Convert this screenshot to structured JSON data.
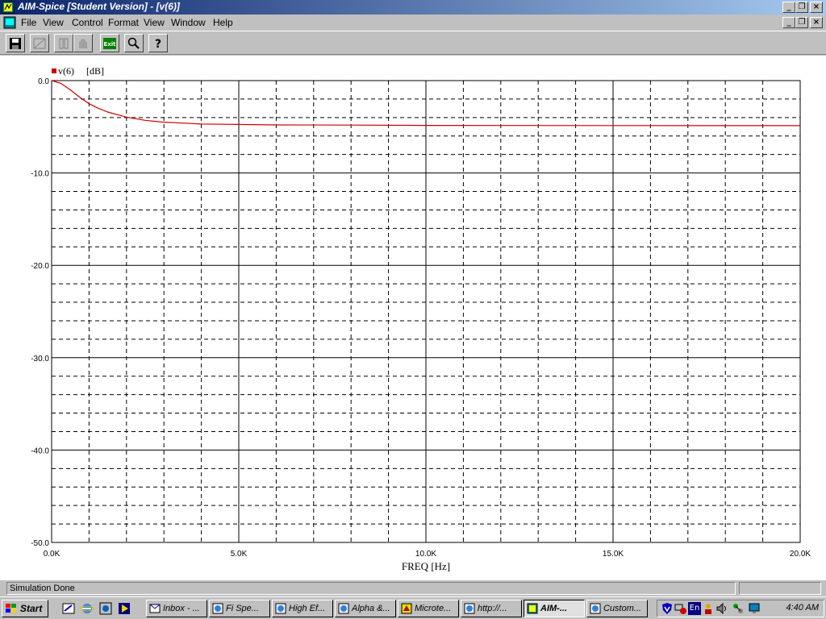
{
  "window": {
    "title": "AIM-Spice [Student Version] - [v(6)]",
    "title_colors": {
      "start": "#0a246a",
      "end": "#a6caf0"
    },
    "controls": {
      "minimize": "_",
      "restore": "❐",
      "close": "×"
    }
  },
  "menu": {
    "items": [
      "File",
      "View",
      "Control",
      "Format",
      "View",
      "Window",
      "Help"
    ],
    "doc_controls": {
      "minimize": "_",
      "restore": "❐",
      "close": "×"
    }
  },
  "toolbar": {
    "buttons": [
      {
        "name": "save-icon"
      },
      {
        "name": "erase-icon"
      },
      {
        "name": "pause-icon"
      },
      {
        "name": "hand-icon"
      },
      {
        "name": "exit-icon",
        "label": "Exit"
      },
      {
        "name": "zoom-icon"
      },
      {
        "name": "help-icon",
        "label": "?"
      }
    ]
  },
  "chart_data": {
    "type": "line",
    "legend": {
      "entries": [
        "v(6)"
      ],
      "unit": "[dB]",
      "placement": "top-left"
    },
    "xlabel": "FREQ [Hz]",
    "xlim": [
      0,
      20000
    ],
    "ylim": [
      -50,
      0
    ],
    "x_tick_labels": [
      "0.0K",
      "5.0K",
      "10.0K",
      "15.0K",
      "20.0K"
    ],
    "y_tick_labels": [
      "0.0",
      "-10.0",
      "-20.0",
      "-30.0",
      "-40.0",
      "-50.0"
    ],
    "grid": true,
    "series": [
      {
        "name": "v(6)",
        "color": "#d00000",
        "x": [
          0,
          250,
          500,
          750,
          1000,
          1250,
          1500,
          2000,
          2500,
          3000,
          3500,
          4000,
          5000,
          6000,
          8000,
          10000,
          12000,
          15000,
          20000
        ],
        "values": [
          0,
          -0.3,
          -1.0,
          -1.8,
          -2.5,
          -3.0,
          -3.4,
          -3.95,
          -4.3,
          -4.5,
          -4.6,
          -4.7,
          -4.75,
          -4.8,
          -4.82,
          -4.85,
          -4.86,
          -4.87,
          -4.88
        ]
      }
    ]
  },
  "status": {
    "text": "Simulation Done"
  },
  "taskbar": {
    "start_label": "Start",
    "quick_launch": [
      "outlook-express-icon",
      "internet-explorer-icon",
      "channels-icon",
      "media-player-icon"
    ],
    "tasks": [
      {
        "label": "Inbox - ...",
        "icon": "inbox-icon",
        "active": false
      },
      {
        "label": "Fi Spe...",
        "icon": "ie-page-icon",
        "active": false
      },
      {
        "label": "High Ef...",
        "icon": "ie-page-icon",
        "active": false
      },
      {
        "label": "Alpha &...",
        "icon": "ie-page-icon",
        "active": false
      },
      {
        "label": "Microte...",
        "icon": "app-icon",
        "active": false
      },
      {
        "label": "http://...",
        "icon": "ie-page-icon",
        "active": false
      },
      {
        "label": "AIM-...",
        "icon": "aimspice-icon",
        "active": true
      },
      {
        "label": "Custom...",
        "icon": "ie-page-icon",
        "active": false
      }
    ],
    "tray_icons": [
      "shield-icon",
      "network-icon",
      "language-icon",
      "en-icon",
      "volume-icon",
      "connection-icon",
      "monitor-icon"
    ],
    "language": "En",
    "clock": "4:40 AM"
  }
}
